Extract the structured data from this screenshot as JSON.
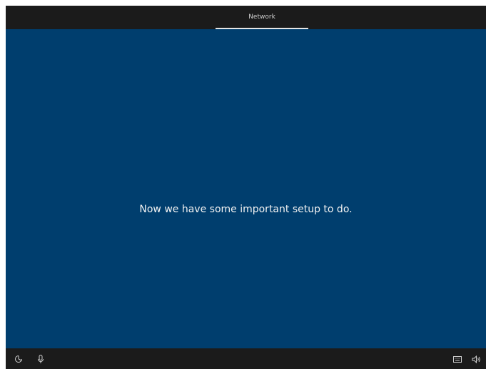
{
  "header": {
    "active_tab": "Network"
  },
  "main": {
    "message": "Now we have some important setup to do."
  },
  "footer": {
    "left_icons": [
      "ease-of-access-icon",
      "microphone-icon"
    ],
    "right_icons": [
      "keyboard-icon",
      "volume-icon"
    ]
  },
  "colors": {
    "background": "#003e6e",
    "bars": "#1b1b1b",
    "text": "#f2f2f2"
  }
}
